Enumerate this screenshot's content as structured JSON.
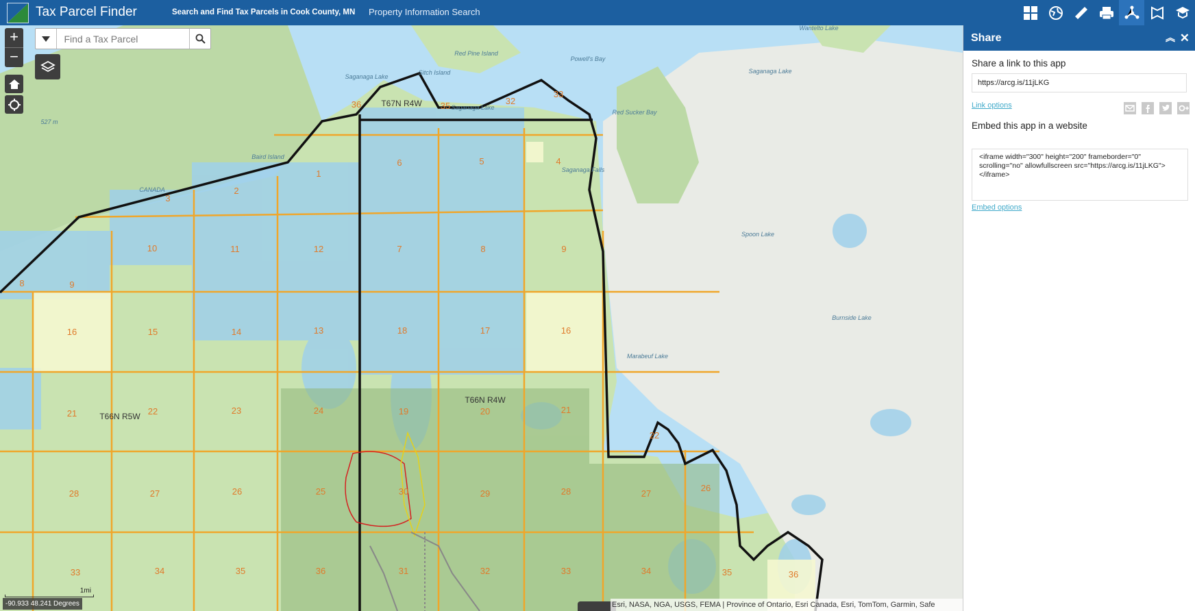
{
  "header": {
    "title": "Tax Parcel Finder",
    "subtitle": "Search and Find Tax Parcels in Cook County, MN",
    "link": "Property Information Search",
    "tools": [
      "grid-icon",
      "basemap-icon",
      "measure-icon",
      "print-icon",
      "share-icon",
      "draw-icon",
      "about-icon"
    ]
  },
  "search": {
    "placeholder": "Find a Tax Parcel",
    "value": ""
  },
  "zoom": {
    "in": "+",
    "out": "−"
  },
  "map": {
    "scale_label": "1mi",
    "coordinates": "-90.933 48.241 Degrees",
    "attribution": "Esri, NASA, NGA, USGS, FEMA | Province of Ontario, Esri Canada, Esri, TomTom, Garmin, Safe",
    "townships": [
      "T67N R4W",
      "T66N R4W",
      "T66N R5W"
    ],
    "features": [
      "Saganaga Lake",
      "Saganaga Lake",
      "Sitch Island",
      "Red Pine Island",
      "Powell's Bay",
      "Wantelto Lake",
      "Saganaga Lake",
      "Red Sucker Bay",
      "Baird Island",
      "Spoon Lake",
      "Burnside Lake",
      "Marabeuf Lake",
      "CANADA",
      "Saganaga Falls",
      "527 m"
    ],
    "sections": [
      "36",
      "35",
      "32",
      "33",
      "6",
      "5",
      "4",
      "3",
      "2",
      "1",
      "10",
      "11",
      "12",
      "7",
      "8",
      "9",
      "8",
      "9",
      "16",
      "15",
      "14",
      "13",
      "18",
      "17",
      "16",
      "21",
      "22",
      "23",
      "24",
      "19",
      "20",
      "21",
      "22",
      "28",
      "27",
      "26",
      "25",
      "30",
      "29",
      "28",
      "27",
      "26",
      "33",
      "34",
      "35",
      "36",
      "31",
      "32",
      "33",
      "34",
      "35",
      "36"
    ]
  },
  "share_panel": {
    "title": "Share",
    "link_label": "Share a link to this app",
    "link_value": "https://arcg.is/11jLKG",
    "link_options": "Link options",
    "embed_label": "Embed this app in a website",
    "embed_value": "<iframe width=\"300\" height=\"200\" frameborder=\"0\" scrolling=\"no\" allowfullscreen src=\"https://arcg.is/11jLKG\"></iframe>",
    "embed_options": "Embed options",
    "social": [
      "email-icon",
      "facebook-icon",
      "twitter-icon",
      "googleplus-icon"
    ]
  },
  "colors": {
    "header": "#1c5fa0",
    "water": "#b8dff5",
    "land": "#c9e3b1",
    "grid": "#f0a62a",
    "link": "#3fa9c9"
  }
}
